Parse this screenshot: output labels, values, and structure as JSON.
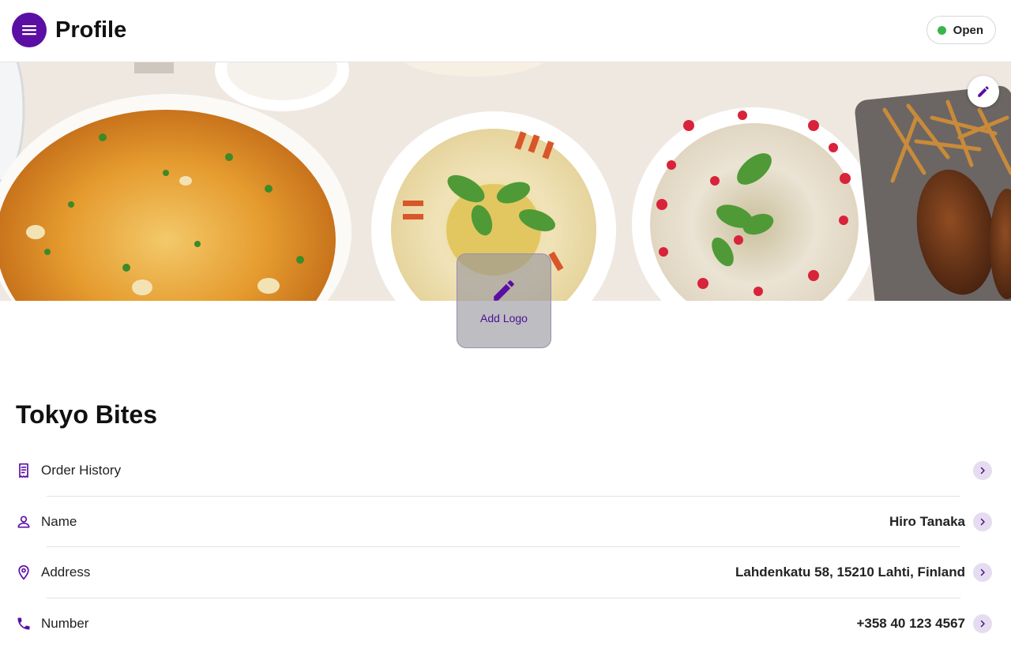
{
  "header": {
    "title": "Profile",
    "status_label": "Open",
    "status_color": "#3cb44b",
    "menu_icon": "menu-icon"
  },
  "banner": {
    "image_description_icon": "banner-photo",
    "edit_icon": "pencil-icon"
  },
  "logo": {
    "label": "Add Logo",
    "icon": "pencil-icon"
  },
  "restaurant": {
    "name": "Tokyo Bites"
  },
  "rows": [
    {
      "icon": "receipt-icon",
      "label": "Order History",
      "value": ""
    },
    {
      "icon": "person-icon",
      "label": "Name",
      "value": "Hiro Tanaka"
    },
    {
      "icon": "location-pin-icon",
      "label": "Address",
      "value": "Lahdenkatu 58, 15210 Lahti, Finland"
    },
    {
      "icon": "phone-icon",
      "label": "Number",
      "value": "+358 40 123 4567"
    }
  ],
  "colors": {
    "accent": "#5b0ea4",
    "chevron_bg": "#e6dcef"
  }
}
